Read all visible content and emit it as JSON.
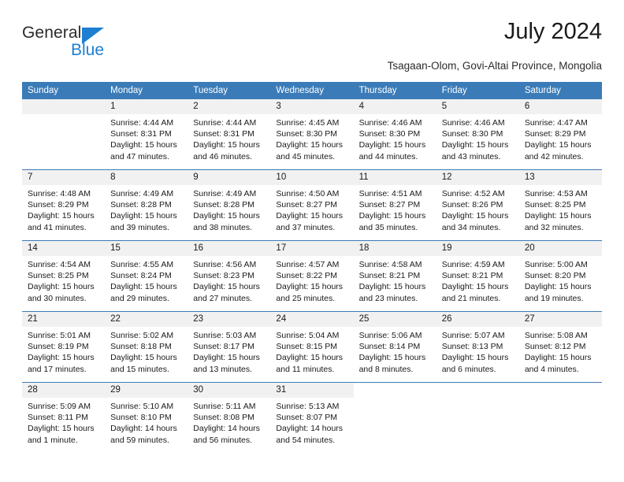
{
  "brand": {
    "word1": "General",
    "word2": "Blue",
    "triangle_color": "#1c7fd1"
  },
  "header": {
    "title": "July 2024",
    "subtitle": "Tsagaan-Olom, Govi-Altai Province, Mongolia"
  },
  "theme": {
    "header_blue": "#3b7cb8",
    "daynum_gray": "#f1f1f1",
    "text": "#1a1a1a"
  },
  "weekdays": [
    "Sunday",
    "Monday",
    "Tuesday",
    "Wednesday",
    "Thursday",
    "Friday",
    "Saturday"
  ],
  "labels": {
    "sunrise": "Sunrise:",
    "sunset": "Sunset:",
    "daylight": "Daylight:"
  },
  "weeks": [
    [
      {
        "day": "",
        "empty": true
      },
      {
        "day": "1",
        "sunrise": "Sunrise: 4:44 AM",
        "sunset": "Sunset: 8:31 PM",
        "daylight1": "Daylight: 15 hours",
        "daylight2": "and 47 minutes."
      },
      {
        "day": "2",
        "sunrise": "Sunrise: 4:44 AM",
        "sunset": "Sunset: 8:31 PM",
        "daylight1": "Daylight: 15 hours",
        "daylight2": "and 46 minutes."
      },
      {
        "day": "3",
        "sunrise": "Sunrise: 4:45 AM",
        "sunset": "Sunset: 8:30 PM",
        "daylight1": "Daylight: 15 hours",
        "daylight2": "and 45 minutes."
      },
      {
        "day": "4",
        "sunrise": "Sunrise: 4:46 AM",
        "sunset": "Sunset: 8:30 PM",
        "daylight1": "Daylight: 15 hours",
        "daylight2": "and 44 minutes."
      },
      {
        "day": "5",
        "sunrise": "Sunrise: 4:46 AM",
        "sunset": "Sunset: 8:30 PM",
        "daylight1": "Daylight: 15 hours",
        "daylight2": "and 43 minutes."
      },
      {
        "day": "6",
        "sunrise": "Sunrise: 4:47 AM",
        "sunset": "Sunset: 8:29 PM",
        "daylight1": "Daylight: 15 hours",
        "daylight2": "and 42 minutes."
      }
    ],
    [
      {
        "day": "7",
        "sunrise": "Sunrise: 4:48 AM",
        "sunset": "Sunset: 8:29 PM",
        "daylight1": "Daylight: 15 hours",
        "daylight2": "and 41 minutes."
      },
      {
        "day": "8",
        "sunrise": "Sunrise: 4:49 AM",
        "sunset": "Sunset: 8:28 PM",
        "daylight1": "Daylight: 15 hours",
        "daylight2": "and 39 minutes."
      },
      {
        "day": "9",
        "sunrise": "Sunrise: 4:49 AM",
        "sunset": "Sunset: 8:28 PM",
        "daylight1": "Daylight: 15 hours",
        "daylight2": "and 38 minutes."
      },
      {
        "day": "10",
        "sunrise": "Sunrise: 4:50 AM",
        "sunset": "Sunset: 8:27 PM",
        "daylight1": "Daylight: 15 hours",
        "daylight2": "and 37 minutes."
      },
      {
        "day": "11",
        "sunrise": "Sunrise: 4:51 AM",
        "sunset": "Sunset: 8:27 PM",
        "daylight1": "Daylight: 15 hours",
        "daylight2": "and 35 minutes."
      },
      {
        "day": "12",
        "sunrise": "Sunrise: 4:52 AM",
        "sunset": "Sunset: 8:26 PM",
        "daylight1": "Daylight: 15 hours",
        "daylight2": "and 34 minutes."
      },
      {
        "day": "13",
        "sunrise": "Sunrise: 4:53 AM",
        "sunset": "Sunset: 8:25 PM",
        "daylight1": "Daylight: 15 hours",
        "daylight2": "and 32 minutes."
      }
    ],
    [
      {
        "day": "14",
        "sunrise": "Sunrise: 4:54 AM",
        "sunset": "Sunset: 8:25 PM",
        "daylight1": "Daylight: 15 hours",
        "daylight2": "and 30 minutes."
      },
      {
        "day": "15",
        "sunrise": "Sunrise: 4:55 AM",
        "sunset": "Sunset: 8:24 PM",
        "daylight1": "Daylight: 15 hours",
        "daylight2": "and 29 minutes."
      },
      {
        "day": "16",
        "sunrise": "Sunrise: 4:56 AM",
        "sunset": "Sunset: 8:23 PM",
        "daylight1": "Daylight: 15 hours",
        "daylight2": "and 27 minutes."
      },
      {
        "day": "17",
        "sunrise": "Sunrise: 4:57 AM",
        "sunset": "Sunset: 8:22 PM",
        "daylight1": "Daylight: 15 hours",
        "daylight2": "and 25 minutes."
      },
      {
        "day": "18",
        "sunrise": "Sunrise: 4:58 AM",
        "sunset": "Sunset: 8:21 PM",
        "daylight1": "Daylight: 15 hours",
        "daylight2": "and 23 minutes."
      },
      {
        "day": "19",
        "sunrise": "Sunrise: 4:59 AM",
        "sunset": "Sunset: 8:21 PM",
        "daylight1": "Daylight: 15 hours",
        "daylight2": "and 21 minutes."
      },
      {
        "day": "20",
        "sunrise": "Sunrise: 5:00 AM",
        "sunset": "Sunset: 8:20 PM",
        "daylight1": "Daylight: 15 hours",
        "daylight2": "and 19 minutes."
      }
    ],
    [
      {
        "day": "21",
        "sunrise": "Sunrise: 5:01 AM",
        "sunset": "Sunset: 8:19 PM",
        "daylight1": "Daylight: 15 hours",
        "daylight2": "and 17 minutes."
      },
      {
        "day": "22",
        "sunrise": "Sunrise: 5:02 AM",
        "sunset": "Sunset: 8:18 PM",
        "daylight1": "Daylight: 15 hours",
        "daylight2": "and 15 minutes."
      },
      {
        "day": "23",
        "sunrise": "Sunrise: 5:03 AM",
        "sunset": "Sunset: 8:17 PM",
        "daylight1": "Daylight: 15 hours",
        "daylight2": "and 13 minutes."
      },
      {
        "day": "24",
        "sunrise": "Sunrise: 5:04 AM",
        "sunset": "Sunset: 8:15 PM",
        "daylight1": "Daylight: 15 hours",
        "daylight2": "and 11 minutes."
      },
      {
        "day": "25",
        "sunrise": "Sunrise: 5:06 AM",
        "sunset": "Sunset: 8:14 PM",
        "daylight1": "Daylight: 15 hours",
        "daylight2": "and 8 minutes."
      },
      {
        "day": "26",
        "sunrise": "Sunrise: 5:07 AM",
        "sunset": "Sunset: 8:13 PM",
        "daylight1": "Daylight: 15 hours",
        "daylight2": "and 6 minutes."
      },
      {
        "day": "27",
        "sunrise": "Sunrise: 5:08 AM",
        "sunset": "Sunset: 8:12 PM",
        "daylight1": "Daylight: 15 hours",
        "daylight2": "and 4 minutes."
      }
    ],
    [
      {
        "day": "28",
        "sunrise": "Sunrise: 5:09 AM",
        "sunset": "Sunset: 8:11 PM",
        "daylight1": "Daylight: 15 hours",
        "daylight2": "and 1 minute."
      },
      {
        "day": "29",
        "sunrise": "Sunrise: 5:10 AM",
        "sunset": "Sunset: 8:10 PM",
        "daylight1": "Daylight: 14 hours",
        "daylight2": "and 59 minutes."
      },
      {
        "day": "30",
        "sunrise": "Sunrise: 5:11 AM",
        "sunset": "Sunset: 8:08 PM",
        "daylight1": "Daylight: 14 hours",
        "daylight2": "and 56 minutes."
      },
      {
        "day": "31",
        "sunrise": "Sunrise: 5:13 AM",
        "sunset": "Sunset: 8:07 PM",
        "daylight1": "Daylight: 14 hours",
        "daylight2": "and 54 minutes."
      },
      {
        "day": "",
        "blank": true
      },
      {
        "day": "",
        "blank": true
      },
      {
        "day": "",
        "blank": true
      }
    ]
  ]
}
